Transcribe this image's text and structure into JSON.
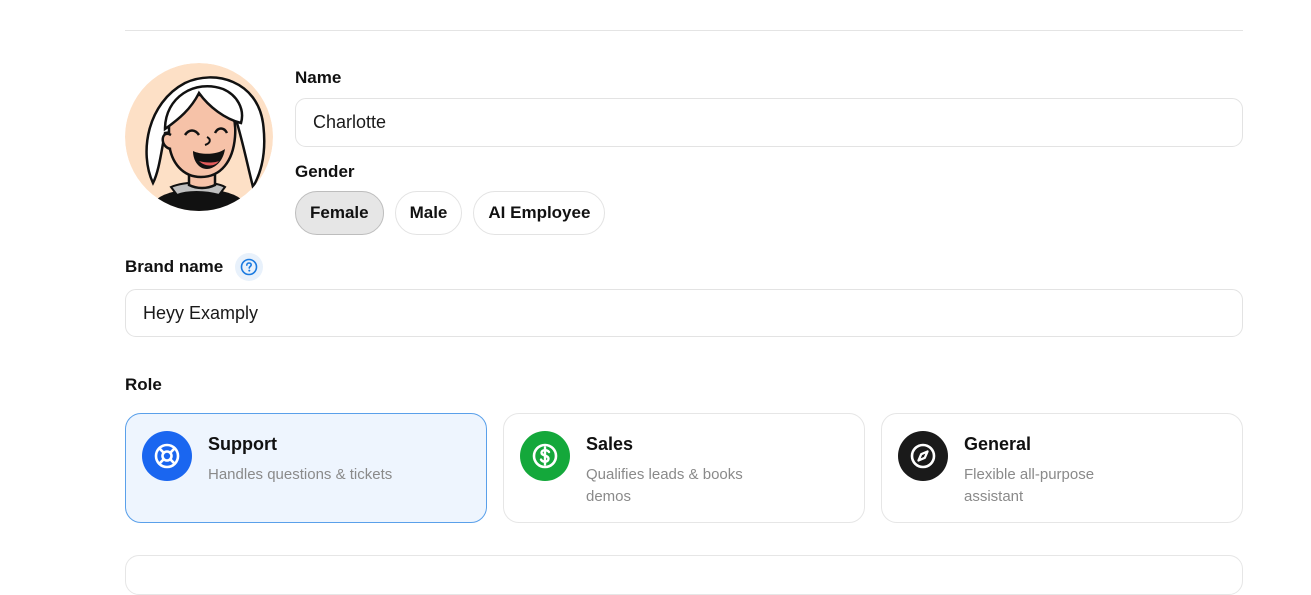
{
  "name": {
    "label": "Name",
    "value": "Charlotte"
  },
  "gender": {
    "label": "Gender",
    "options": [
      "Female",
      "Male",
      "AI Employee"
    ],
    "selected": "Female"
  },
  "brand": {
    "label": "Brand name",
    "value": "Heyy Examply",
    "help_icon": "question-circle-icon"
  },
  "role": {
    "label": "Role",
    "selected": "Support",
    "options": [
      {
        "title": "Support",
        "desc": "Handles questions & tickets",
        "icon": "lifebuoy-icon",
        "color": "#1a66f0"
      },
      {
        "title": "Sales",
        "desc": "Qualifies leads & books demos",
        "icon": "dollar-circle-icon",
        "color": "#14a83b"
      },
      {
        "title": "General",
        "desc": "Flexible all-purpose assistant",
        "icon": "compass-icon",
        "color": "#1a1a1a"
      }
    ]
  },
  "colors": {
    "accent": "#1a66f0",
    "selected_card_bg": "#eef5fe",
    "selected_card_border": "#5aa0ea",
    "avatar_bg": "#fde0c6"
  }
}
